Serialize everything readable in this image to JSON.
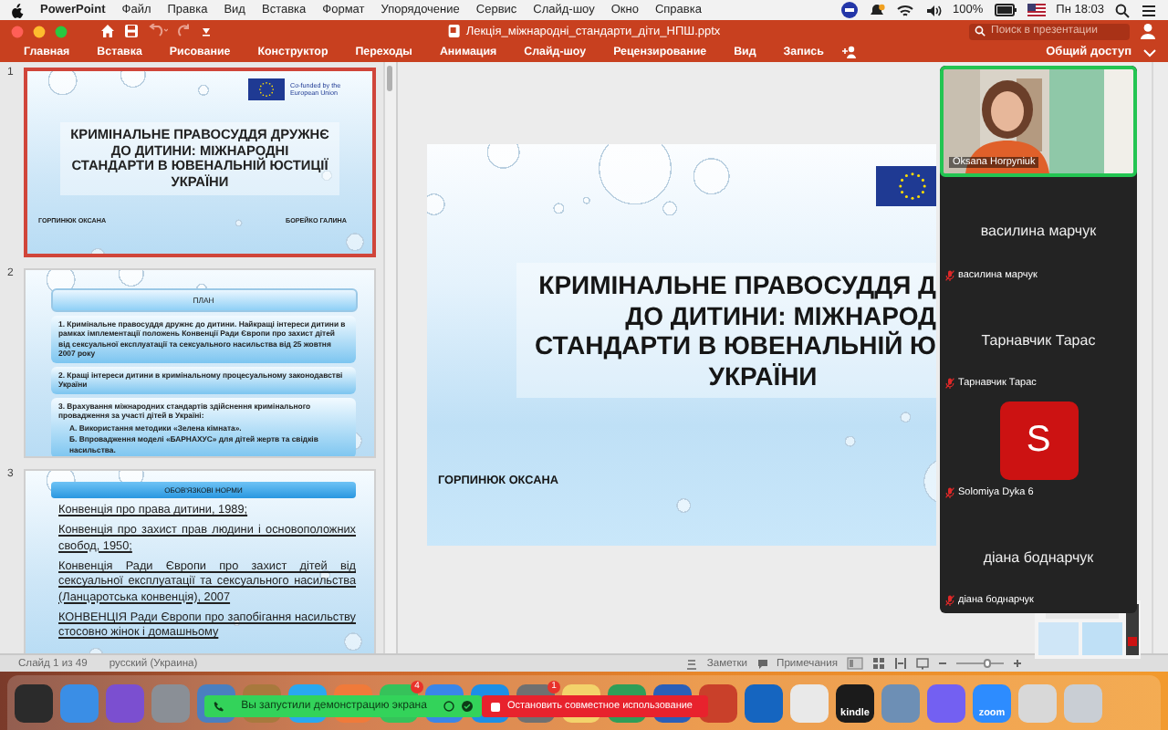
{
  "menubar": {
    "app": "PowerPoint",
    "items": [
      "Файл",
      "Правка",
      "Вид",
      "Вставка",
      "Формат",
      "Упорядочение",
      "Сервис",
      "Слайд-шоу",
      "Окно",
      "Справка"
    ],
    "battery": "100%",
    "clock": "Пн 18:03"
  },
  "titlebar": {
    "document": "Лекція_міжнародні_стандарти_діти_НПШ.pptx",
    "search": {
      "placeholder": "Поиск в презентации"
    }
  },
  "ribbon": {
    "tabs": [
      {
        "label": "Главная",
        "selected": false
      },
      {
        "label": "Вставка",
        "selected": false
      },
      {
        "label": "Рисование",
        "selected": false
      },
      {
        "label": "Конструктор",
        "selected": false
      },
      {
        "label": "Переходы",
        "selected": false
      },
      {
        "label": "Анимация",
        "selected": false
      },
      {
        "label": "Слайд-шоу",
        "selected": false
      },
      {
        "label": "Рецензирование",
        "selected": false
      },
      {
        "label": "Вид",
        "selected": false
      },
      {
        "label": "Запись",
        "selected": false
      }
    ],
    "share": "Общий доступ"
  },
  "thumbnails": [
    {
      "number": "1",
      "selected": true,
      "kind": "title",
      "eu": "Co-funded by the European Union",
      "title": [
        "КРИМІНАЛЬНЕ ПРАВОСУДДЯ ДРУЖНЄ",
        "ДО ДИТИНИ: МІЖНАРОДНІ",
        "СТАНДАРТИ В ЮВЕНАЛЬНІЙ ЮСТИЦІЇ",
        "УКРАЇНИ"
      ],
      "authors": [
        "ГОРПИНЮК ОКСАНА",
        "БОРЕЙКО ГАЛИНА"
      ]
    },
    {
      "number": "2",
      "selected": false,
      "kind": "plan",
      "heading": "ПЛАН",
      "blocks": [
        {
          "text": "1. Кримінальне правосуддя дружнє до дитини. Найкращі інтереси дитини в рамках імплементації положень Конвенції Ради Європи про захист дітей від сексуальної експлуатації та сексуального насильства від 25 жовтня 2007 року"
        },
        {
          "text": "2. Кращі інтереси дитини в кримінальному процесуальному законодавстві України"
        },
        {
          "text": "3. Врахування міжнародних стандартів здійснення кримінального провадження за участі дітей в Україні:",
          "bullets": [
            "А. Використання методики «Зелена кімната».",
            "Б. Впровадження моделі «БАРНАХУС» для дітей жертв та свідків насильства."
          ]
        }
      ]
    },
    {
      "number": "3",
      "selected": false,
      "kind": "list",
      "heading": "ОБОВ'ЯЗКОВІ НОРМИ",
      "bullets": [
        "Конвенція про права дитини, 1989;",
        "Конвенція про захист прав людини і основоположних свобод, 1950;",
        "Конвенція Ради Європи про захист дітей від сексуальної експлуатації та сексуального насильства (Ланцаротська конвенція), 2007",
        "КОНВЕНЦІЯ Ради Європи про запобігання насильству стосовно жінок і домашньому"
      ]
    }
  ],
  "slide": {
    "title": [
      "КРИМІНАЛЬНЕ ПРАВОСУДДЯ Д",
      "ДО ДИТИНИ: МІЖНАРОД",
      "СТАНДАРТИ В ЮВЕНАЛЬНІЙ Ю",
      "УКРАЇНИ"
    ],
    "author": "ГОРПИНЮК ОКСАНА"
  },
  "zoom": {
    "participants": [
      {
        "kind": "video",
        "name": "Oksana Horpyniuk"
      },
      {
        "kind": "name",
        "display": "василина марчук",
        "name": "василина марчук",
        "muted": true
      },
      {
        "kind": "name",
        "display": "Тарнавчик Тарас",
        "name": "Тарнавчик Тарас",
        "muted": true
      },
      {
        "kind": "avatar",
        "display": "S",
        "name": "Solomiya Dyka 6",
        "muted": true
      },
      {
        "kind": "name",
        "display": "діана боднарчук",
        "name": "діана боднарчук",
        "muted": true
      }
    ]
  },
  "statusbar": {
    "slide": "Слайд 1 из 49",
    "language": "русский (Украина)",
    "notes": "Заметки",
    "comments": "Примечания",
    "zoom": {
      "level": 0.65
    }
  },
  "dock": {
    "items": [
      {
        "color": "#2b2b2b"
      },
      {
        "color": "#3a8ee6"
      },
      {
        "color": "#7b4fd0"
      },
      {
        "color": "#8a8f96"
      },
      {
        "color": "#4a7fc0"
      },
      {
        "color": "#a8793d"
      },
      {
        "color": "#29a8f0"
      },
      {
        "color": "#f07a3a"
      },
      {
        "color": "#36c25a",
        "badge": "4"
      },
      {
        "color": "#3a86e8"
      },
      {
        "color": "#1d8fe6"
      },
      {
        "color": "#707070",
        "badge": "1"
      },
      {
        "color": "#f3d36b"
      },
      {
        "color": "#2f9e58"
      },
      {
        "color": "#2b5fb8"
      },
      {
        "color": "#c9402a"
      },
      {
        "color": "#1565c0"
      },
      {
        "color": "#e9e9e9"
      },
      {
        "color": "#1b1b1b",
        "label": "kindle"
      },
      {
        "color": "#6d8fb5"
      },
      {
        "color": "#7360f2"
      },
      {
        "color": "#2d8cff",
        "label": "zoom"
      },
      {
        "color": "#d8d8d8"
      },
      {
        "color": "#c9ced4"
      }
    ],
    "banner": "Вы запустили демонстрацию экрана",
    "stop": "Остановить совместное использование"
  }
}
